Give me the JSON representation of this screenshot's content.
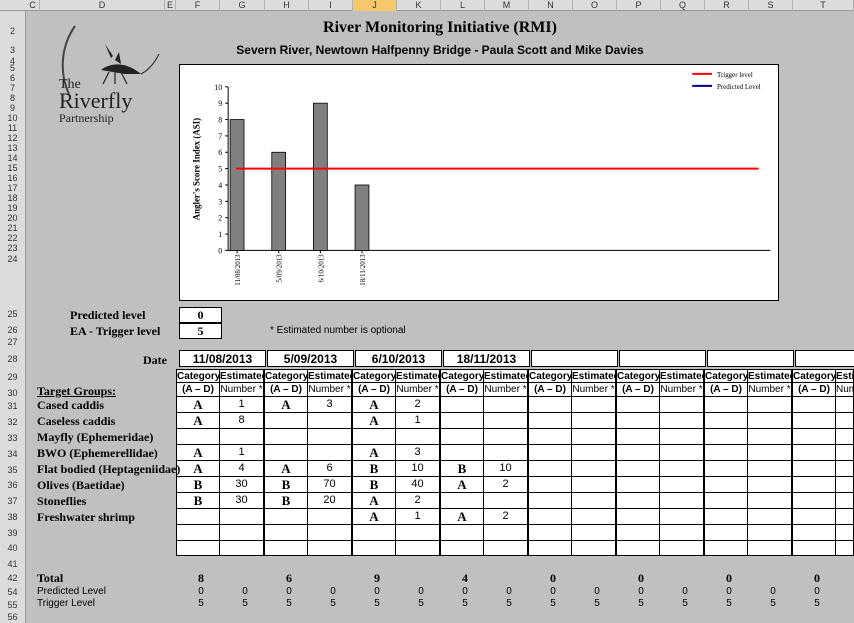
{
  "columns": [
    "C",
    "D",
    "E",
    "F",
    "G",
    "H",
    "I",
    "J",
    "K",
    "L",
    "M",
    "N",
    "O",
    "P",
    "Q",
    "R",
    "S",
    "T"
  ],
  "selected_column": "J",
  "rows": [
    "2",
    "3",
    "4",
    "5",
    "6",
    "7",
    "8",
    "9",
    "10",
    "11",
    "12",
    "13",
    "14",
    "15",
    "16",
    "17",
    "18",
    "19",
    "20",
    "21",
    "22",
    "23",
    "24",
    "25",
    "26",
    "27",
    "28",
    "29",
    "30",
    "31",
    "32",
    "33",
    "34",
    "35",
    "36",
    "37",
    "38",
    "39",
    "40",
    "41",
    "42",
    "54",
    "55",
    "56"
  ],
  "title": "River Monitoring Initiative (RMI)",
  "subtitle": "Severn River, Newtown Halfpenny Bridge - Paula Scott and Mike Davies",
  "logo": {
    "line1": "The",
    "line2": "Riverfly",
    "line3": "Partnership"
  },
  "chart_data": {
    "type": "bar",
    "categories": [
      "11/08/2013",
      "5/09/2013",
      "6/10/2013",
      "18/11/2013"
    ],
    "values": [
      8,
      6,
      9,
      4
    ],
    "ylabel": "Angler's Score Index (ASI)",
    "ylim": [
      0,
      10
    ],
    "yticks": [
      "0",
      "1",
      "2",
      "3",
      "4",
      "5",
      "6",
      "7",
      "8",
      "9",
      "10"
    ],
    "trigger_level": 5,
    "legend": [
      {
        "name": "Trigger level",
        "color": "#ff0000"
      },
      {
        "name": "Predicted Level",
        "color": "#00008b"
      }
    ],
    "legend_position": "top-right",
    "bar_color": "#808080"
  },
  "predicted_level_label": "Predicted level",
  "predicted_level_value": "0",
  "trigger_level_label": "EA - Trigger level",
  "trigger_level_value": "5",
  "note": "* Estimated number is optional",
  "date_label": "Date",
  "dates": [
    "11/08/2013",
    "5/09/2013",
    "6/10/2013",
    "18/11/2013",
    "",
    "",
    "",
    ""
  ],
  "col_header1": [
    "Category",
    "Estimated"
  ],
  "col_header2": [
    "(A – D)",
    "Number *"
  ],
  "target_groups_label": "Target Groups:",
  "groups": [
    {
      "name": "Cased caddis",
      "vals": [
        [
          "A",
          "1"
        ],
        [
          "A",
          "3"
        ],
        [
          "A",
          "2"
        ],
        [
          "",
          ""
        ]
      ]
    },
    {
      "name": "Caseless caddis",
      "vals": [
        [
          "A",
          "8"
        ],
        [
          "",
          ""
        ],
        [
          "A",
          "1"
        ],
        [
          "",
          ""
        ]
      ]
    },
    {
      "name": "Mayfly (Ephemeridae)",
      "vals": [
        [
          "",
          ""
        ],
        [
          "",
          ""
        ],
        [
          "",
          ""
        ],
        [
          "",
          ""
        ]
      ]
    },
    {
      "name": "BWO (Ephemerellidae)",
      "vals": [
        [
          "A",
          "1"
        ],
        [
          "",
          ""
        ],
        [
          "A",
          "3"
        ],
        [
          "",
          ""
        ]
      ]
    },
    {
      "name": "Flat bodied (Heptageniidae)",
      "vals": [
        [
          "A",
          "4"
        ],
        [
          "A",
          "6"
        ],
        [
          "B",
          "10"
        ],
        [
          "B",
          "10"
        ]
      ]
    },
    {
      "name": "Olives (Baetidae)",
      "vals": [
        [
          "B",
          "30"
        ],
        [
          "B",
          "70"
        ],
        [
          "B",
          "40"
        ],
        [
          "A",
          "2"
        ]
      ]
    },
    {
      "name": "Stoneflies",
      "vals": [
        [
          "B",
          "30"
        ],
        [
          "B",
          "20"
        ],
        [
          "A",
          "2"
        ],
        [
          "",
          ""
        ]
      ]
    },
    {
      "name": "Freshwater shrimp",
      "vals": [
        [
          "",
          ""
        ],
        [
          "",
          ""
        ],
        [
          "A",
          "1"
        ],
        [
          "A",
          "2"
        ]
      ]
    }
  ],
  "total_label": "Total",
  "totals": [
    "8",
    "6",
    "9",
    "4",
    "0",
    "0",
    "0",
    "0"
  ],
  "predicted_row_label": "Predicted Level",
  "trigger_row_label": "Trigger Level",
  "predicted_row_values": [
    "0",
    "0",
    "0",
    "0",
    "0",
    "0",
    "0",
    "0",
    "0",
    "0",
    "0",
    "0",
    "0",
    "0",
    "0"
  ],
  "trigger_row_values": [
    "5",
    "5",
    "5",
    "5",
    "5",
    "5",
    "5",
    "5",
    "5",
    "5",
    "5",
    "5",
    "5",
    "5",
    "5"
  ]
}
